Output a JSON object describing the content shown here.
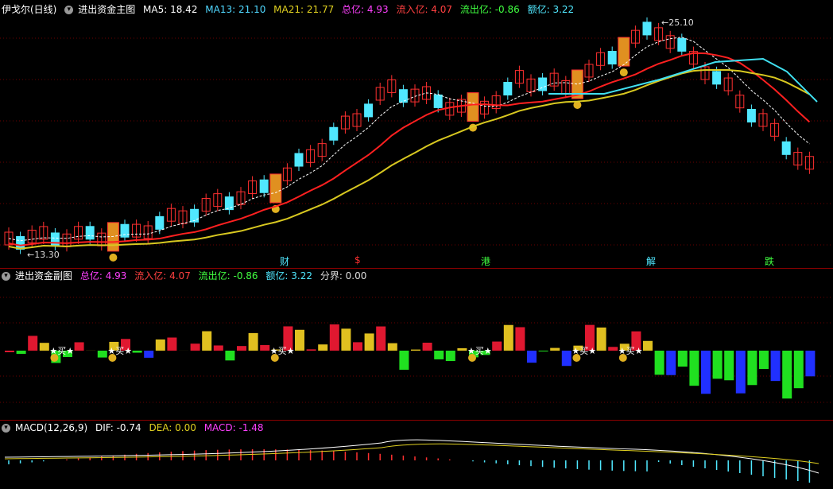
{
  "main": {
    "title": "伊戈尔(日线)",
    "indicator": "进出资金主图",
    "ma5": "MA5: 18.42",
    "ma13": "MA13: 21.10",
    "ma21": "MA21: 21.77",
    "total": "总亿: 4.93",
    "inflow": "流入亿: 4.07",
    "outflow": "流出亿: -0.86",
    "amount": "额亿: 3.22",
    "high_label": "25.10",
    "low_label": "13.30",
    "event_labels": [
      "财",
      "$",
      "港",
      "解",
      "跌"
    ],
    "colors": {
      "ma5": "#ffffff",
      "ma13": "#ff2020",
      "ma21": "#d8c820",
      "ma_slow": "#40e0f0",
      "up": "#ff3030",
      "down": "#50e8ff"
    }
  },
  "sub": {
    "indicator": "进出资金副图",
    "total": "总亿: 4.93",
    "inflow": "流入亿: 4.07",
    "outflow": "流出亿: -0.86",
    "amount": "额亿: 3.22",
    "divide": "分界: 0.00",
    "buy_label": "买"
  },
  "macd": {
    "indicator": "MACD(12,26,9)",
    "dif": "DIF: -0.74",
    "dea": "DEA: 0.00",
    "macd": "MACD: -1.48"
  }
}
